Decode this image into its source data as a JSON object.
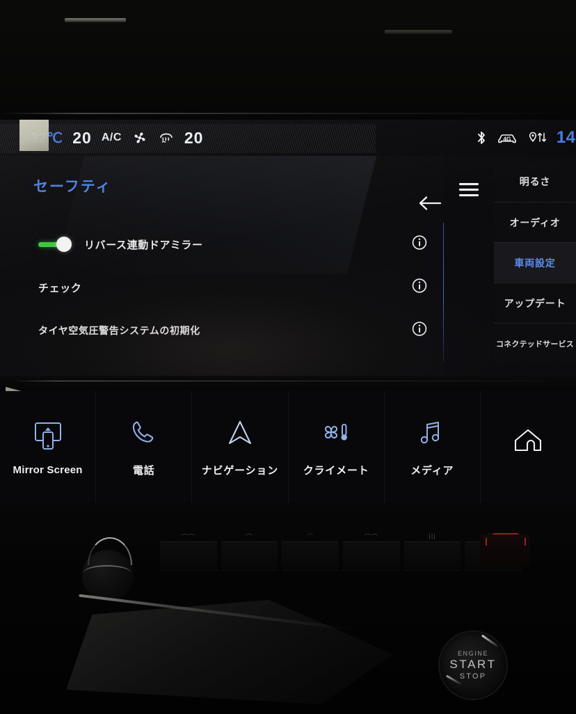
{
  "statusbar": {
    "temperature": "32℃",
    "driver_temp": "20",
    "ac_label": "A/C",
    "fan_icon": "fan-icon",
    "defrost_icon": "defrost-icon",
    "passenger_temp": "20",
    "bluetooth_icon": "bluetooth-icon",
    "network_icon": "4g-car-icon",
    "location_icon": "location-arrows-icon",
    "clock": "14:"
  },
  "screen": {
    "page_title": "セーフティ",
    "back_icon": "back-arrow-icon",
    "menu_icon": "hamburger-menu-icon",
    "rows": [
      {
        "label": "リバース連動ドアミラー",
        "has_toggle": true,
        "toggle_state": "on",
        "info_icon": "info-icon"
      },
      {
        "label": "チェック",
        "has_toggle": false,
        "info_icon": "info-icon"
      },
      {
        "label": "タイヤ空気圧警告システムの初期化",
        "has_toggle": false,
        "info_icon": "info-icon"
      }
    ],
    "side_menu": [
      {
        "label": "明るさ",
        "active": false
      },
      {
        "label": "オーディオ",
        "active": false
      },
      {
        "label": "車両設定",
        "active": true
      },
      {
        "label": "アップデート",
        "active": false
      },
      {
        "label": "コネクテッドサービス",
        "active": false
      }
    ]
  },
  "dock": {
    "items": [
      {
        "label": "Mirror Screen",
        "icon": "mirror-screen-icon",
        "latin": true
      },
      {
        "label": "電話",
        "icon": "phone-icon",
        "latin": false
      },
      {
        "label": "ナビゲーション",
        "icon": "navigation-icon",
        "latin": false
      },
      {
        "label": "クライメート",
        "icon": "climate-icon",
        "latin": false
      },
      {
        "label": "メディア",
        "icon": "media-icon",
        "latin": false
      },
      {
        "label": "",
        "icon": "home-icon",
        "latin": false
      }
    ]
  },
  "console": {
    "start_button": {
      "line1": "ENGINE",
      "line2": "START",
      "line3": "STOP"
    },
    "hvac_ticks": [
      "⌒⌒",
      "⌒",
      "'''",
      "⌒⌒",
      "|||",
      "U̲H̲"
    ],
    "hazard_icon": "hazard-triangle-icon"
  },
  "colors": {
    "accent_blue": "#4a7fe4",
    "toggle_green": "#3cc63c",
    "icon_blue": "#8fb2e8",
    "text_white": "#eceff5",
    "hazard_red": "#c8282 3"
  }
}
